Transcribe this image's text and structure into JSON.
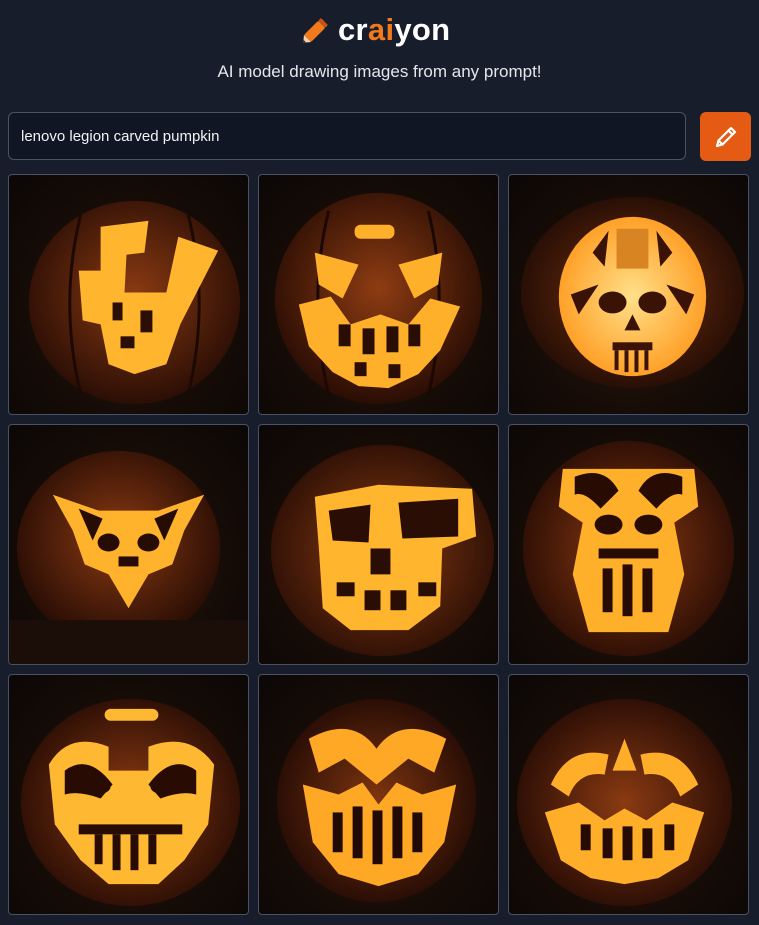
{
  "header": {
    "logo": {
      "prefix": "cr",
      "highlight": "ai",
      "suffix": "yon"
    },
    "tagline": "AI model drawing images from any prompt!",
    "icon": "pencil-icon"
  },
  "prompt": {
    "value": "lenovo legion carved pumpkin"
  },
  "draw_button": {
    "icon": "pencil-icon"
  },
  "images": {
    "count": 9,
    "subject": "carved jack-o'-lantern pumpkin glowing orange"
  },
  "colors": {
    "background": "#171d2b",
    "accent": "#f27a1a",
    "button": "#e55b13",
    "glow": "#ffb52e"
  }
}
